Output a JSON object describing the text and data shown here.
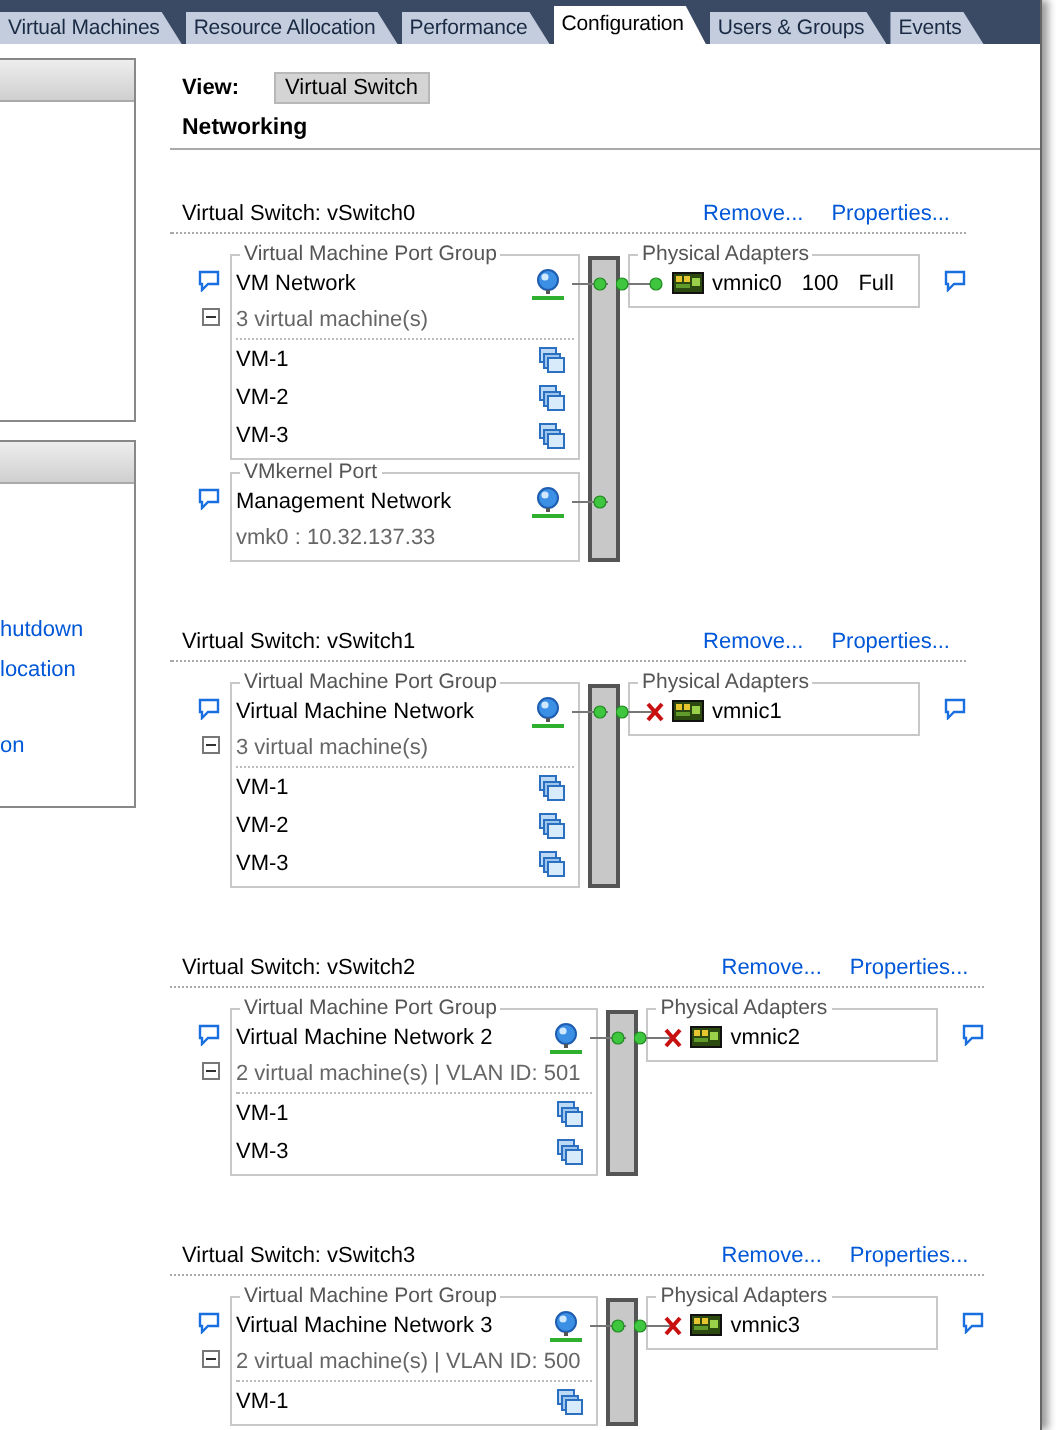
{
  "tabs": [
    {
      "label": "Virtual Machines",
      "selected": false
    },
    {
      "label": "Resource Allocation",
      "selected": false
    },
    {
      "label": "Performance",
      "selected": false
    },
    {
      "label": "Configuration",
      "selected": true
    },
    {
      "label": "Users & Groups",
      "selected": false
    },
    {
      "label": "Events",
      "selected": false
    }
  ],
  "sidebar": {
    "links": [
      "hutdown",
      "location",
      "on"
    ]
  },
  "view": {
    "label": "View:",
    "value": "Virtual Switch"
  },
  "section_title": "Networking",
  "switches": [
    {
      "title": "Virtual Switch: vSwitch0",
      "actions": [
        "Remove...",
        "Properties..."
      ],
      "port_groups": [
        {
          "kind": "vm",
          "group_label": "Virtual Machine Port Group",
          "name": "VM Network",
          "expanded": true,
          "summary": "3 virtual machine(s)",
          "vms": [
            "VM-1",
            "VM-2",
            "VM-3"
          ]
        },
        {
          "kind": "vmkernel",
          "group_label": "VMkernel Port",
          "name": "Management Network",
          "detail": "vmk0 : 10.32.137.33"
        }
      ],
      "adapters": {
        "label": "Physical Adapters",
        "items": [
          {
            "name": "vmnic0",
            "speed": "100",
            "duplex": "Full",
            "connected": true
          }
        ]
      }
    },
    {
      "title": "Virtual Switch: vSwitch1",
      "actions": [
        "Remove...",
        "Properties..."
      ],
      "port_groups": [
        {
          "kind": "vm",
          "group_label": "Virtual Machine Port Group",
          "name": "Virtual Machine Network",
          "expanded": true,
          "summary": "3 virtual machine(s)",
          "vms": [
            "VM-1",
            "VM-2",
            "VM-3"
          ]
        }
      ],
      "adapters": {
        "label": "Physical Adapters",
        "items": [
          {
            "name": "vmnic1",
            "connected": false
          }
        ]
      }
    },
    {
      "title": "Virtual Switch: vSwitch2",
      "actions": [
        "Remove...",
        "Properties..."
      ],
      "port_groups": [
        {
          "kind": "vm",
          "group_label": "Virtual Machine Port Group",
          "name": "Virtual Machine Network 2",
          "expanded": true,
          "summary": "2 virtual machine(s) | VLAN ID: 501",
          "vms": [
            "VM-1",
            "VM-3"
          ]
        }
      ],
      "adapters": {
        "label": "Physical Adapters",
        "items": [
          {
            "name": "vmnic2",
            "connected": false
          }
        ]
      }
    },
    {
      "title": "Virtual Switch: vSwitch3",
      "actions": [
        "Remove...",
        "Properties..."
      ],
      "port_groups": [
        {
          "kind": "vm",
          "group_label": "Virtual Machine Port Group",
          "name": "Virtual Machine Network 3",
          "expanded": true,
          "summary": "2 virtual machine(s) | VLAN ID: 500",
          "vms": [
            "VM-1"
          ]
        }
      ],
      "adapters": {
        "label": "Physical Adapters",
        "items": [
          {
            "name": "vmnic3",
            "connected": false
          }
        ]
      }
    }
  ]
}
